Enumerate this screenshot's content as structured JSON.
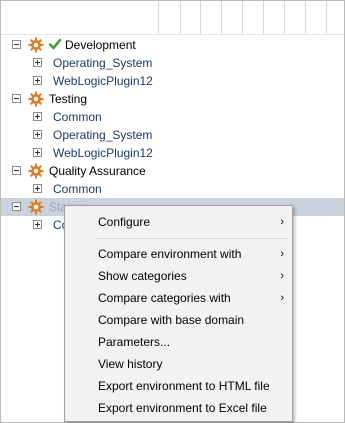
{
  "tree": {
    "rows": [
      {
        "label": "Development",
        "type": "root",
        "expanded": true,
        "icon": "gear-icon",
        "status_icon": "checkmark-icon"
      },
      {
        "label": "Operating_System",
        "type": "child",
        "expanded": false
      },
      {
        "label": "WebLogicPlugin12",
        "type": "child",
        "expanded": false
      },
      {
        "label": "Testing",
        "type": "root",
        "expanded": true,
        "icon": "gear-icon"
      },
      {
        "label": "Common",
        "type": "child",
        "expanded": false
      },
      {
        "label": "Operating_System",
        "type": "child",
        "expanded": false
      },
      {
        "label": "WebLogicPlugin12",
        "type": "child",
        "expanded": false
      },
      {
        "label": "Quality Assurance",
        "type": "root",
        "expanded": true,
        "icon": "gear-icon"
      },
      {
        "label": "Common",
        "type": "child",
        "expanded": false
      },
      {
        "label": "Staging",
        "type": "root",
        "expanded": true,
        "icon": "gear-icon",
        "selected": true
      },
      {
        "label": "Co",
        "type": "child",
        "expanded": false
      }
    ]
  },
  "context_menu": {
    "items": [
      {
        "label": "Configure",
        "submenu": true
      },
      {
        "label": "Compare environment with",
        "submenu": true
      },
      {
        "label": "Show categories",
        "submenu": true
      },
      {
        "label": "Compare categories with",
        "submenu": true
      },
      {
        "label": "Compare with base domain",
        "submenu": false
      },
      {
        "label": "Parameters...",
        "submenu": false
      },
      {
        "label": "View history",
        "submenu": false
      },
      {
        "label": "Export environment to HTML file",
        "submenu": false
      },
      {
        "label": "Export environment to Excel file",
        "submenu": false
      }
    ],
    "submenu_arrow": "›"
  },
  "colors": {
    "selection": "#c9d2dc",
    "child_text": "#1a3a6b",
    "gear": "#e07b2a",
    "check": "#2e9e2e",
    "menu_bg": "#f2f2f2"
  }
}
